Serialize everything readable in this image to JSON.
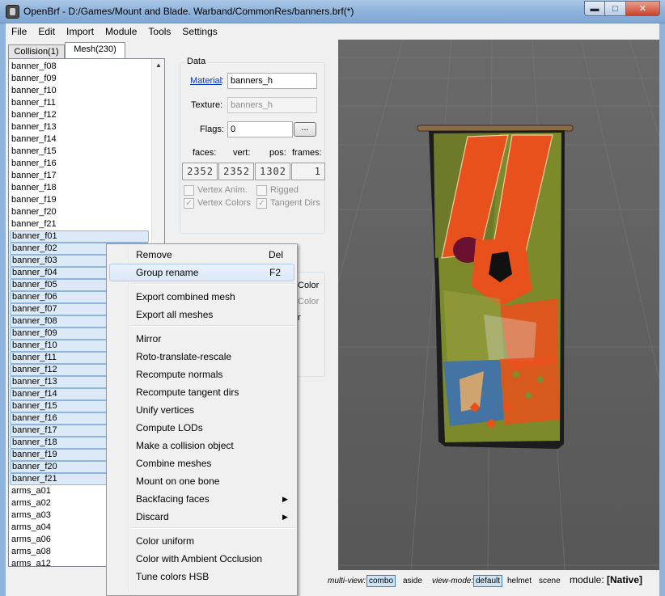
{
  "window": {
    "title": "OpenBrf - D:/Games/Mount and Blade. Warband/CommonRes/banners.brf(*)",
    "min_label": "▬",
    "max_label": "□",
    "close_label": "✕"
  },
  "menu": [
    "File",
    "Edit",
    "Import",
    "Module",
    "Tools",
    "Settings"
  ],
  "tabs": [
    {
      "label": "Collision(1)"
    },
    {
      "label": "Mesh(230)"
    }
  ],
  "list": {
    "scroll_up": "▲",
    "items": [
      {
        "label": "banner_f08",
        "selected": false
      },
      {
        "label": "banner_f09",
        "selected": false
      },
      {
        "label": "banner_f10",
        "selected": false
      },
      {
        "label": "banner_f11",
        "selected": false
      },
      {
        "label": "banner_f12",
        "selected": false
      },
      {
        "label": "banner_f13",
        "selected": false
      },
      {
        "label": "banner_f14",
        "selected": false
      },
      {
        "label": "banner_f15",
        "selected": false
      },
      {
        "label": "banner_f16",
        "selected": false
      },
      {
        "label": "banner_f17",
        "selected": false
      },
      {
        "label": "banner_f18",
        "selected": false
      },
      {
        "label": "banner_f19",
        "selected": false
      },
      {
        "label": "banner_f20",
        "selected": false
      },
      {
        "label": "banner_f21",
        "selected": false
      },
      {
        "label": "banner_f01",
        "selected": true
      },
      {
        "label": "banner_f02",
        "selected": true
      },
      {
        "label": "banner_f03",
        "selected": true
      },
      {
        "label": "banner_f04",
        "selected": true
      },
      {
        "label": "banner_f05",
        "selected": true
      },
      {
        "label": "banner_f06",
        "selected": true
      },
      {
        "label": "banner_f07",
        "selected": true
      },
      {
        "label": "banner_f08",
        "selected": true
      },
      {
        "label": "banner_f09",
        "selected": true
      },
      {
        "label": "banner_f10",
        "selected": true
      },
      {
        "label": "banner_f11",
        "selected": true
      },
      {
        "label": "banner_f12",
        "selected": true
      },
      {
        "label": "banner_f13",
        "selected": true
      },
      {
        "label": "banner_f14",
        "selected": true
      },
      {
        "label": "banner_f15",
        "selected": true
      },
      {
        "label": "banner_f16",
        "selected": true
      },
      {
        "label": "banner_f17",
        "selected": true
      },
      {
        "label": "banner_f18",
        "selected": true
      },
      {
        "label": "banner_f19",
        "selected": true
      },
      {
        "label": "banner_f20",
        "selected": true
      },
      {
        "label": "banner_f21",
        "selected": true
      },
      {
        "label": "arms_a01",
        "selected": false
      },
      {
        "label": "arms_a02",
        "selected": false
      },
      {
        "label": "arms_a03",
        "selected": false
      },
      {
        "label": "arms_a04",
        "selected": false
      },
      {
        "label": "arms_a06",
        "selected": false
      },
      {
        "label": "arms_a08",
        "selected": false
      },
      {
        "label": "arms_a12",
        "selected": false
      }
    ]
  },
  "data_panel": {
    "title": "Data",
    "material_label": "Material",
    "material_colon": ":",
    "material_value": "banners_h",
    "texture_label": "Texture:",
    "texture_value": "banners_h",
    "flags_label": "Flags:",
    "flags_value": "0",
    "flags_button": "...",
    "counters": [
      {
        "header": "faces:",
        "value": "2352"
      },
      {
        "header": "vert:",
        "value": "2352"
      },
      {
        "header": "pos:",
        "value": "1302"
      },
      {
        "header": "frames:",
        "value": "1"
      }
    ],
    "checkboxes": [
      {
        "label": "Vertex Anim.",
        "checked": false
      },
      {
        "label": "Rigged",
        "checked": false
      },
      {
        "label": "Vertex Colors",
        "checked": true
      },
      {
        "label": "Tangent Dirs",
        "checked": true
      }
    ],
    "partial_right": [
      "Color",
      "Color",
      "r"
    ]
  },
  "context_menu": {
    "items": [
      {
        "label": "Remove",
        "shortcut": "Del",
        "highlighted": false
      },
      {
        "label": "Group rename",
        "shortcut": "F2",
        "highlighted": true
      },
      {
        "sep": true
      },
      {
        "label": "Export combined mesh"
      },
      {
        "label": "Export all meshes"
      },
      {
        "sep": true
      },
      {
        "label": "Mirror"
      },
      {
        "label": "Roto-translate-rescale"
      },
      {
        "label": "Recompute normals"
      },
      {
        "label": "Recompute tangent dirs"
      },
      {
        "label": "Unify vertices"
      },
      {
        "label": "Compute LODs"
      },
      {
        "label": "Make a collision object"
      },
      {
        "label": "Combine meshes"
      },
      {
        "label": "Mount on one bone"
      },
      {
        "label": "Backfacing faces",
        "submenu": true
      },
      {
        "label": "Discard",
        "submenu": true
      },
      {
        "sep": true
      },
      {
        "label": "Color uniform"
      },
      {
        "label": "Color with Ambient Occlusion"
      },
      {
        "label": "Tune colors HSB"
      }
    ],
    "submenu_arrow": "▶"
  },
  "statusbar": {
    "multiview_label": "multi-view:",
    "multiview_combo": "combo",
    "multiview_aside": "aside",
    "viewmode_label": "view-mode:",
    "viewmode_default": "default",
    "viewmode_helmet": "helmet",
    "viewmode_scene": "scene",
    "module_label": "module:",
    "module_value": "[Native]"
  },
  "colors": {
    "accent": "#3c7fb1",
    "selection": "#dce9f7",
    "viewport_bg": "#5f5f5f",
    "banner_orange": "#e8501c",
    "banner_green": "#7c8a2c"
  }
}
